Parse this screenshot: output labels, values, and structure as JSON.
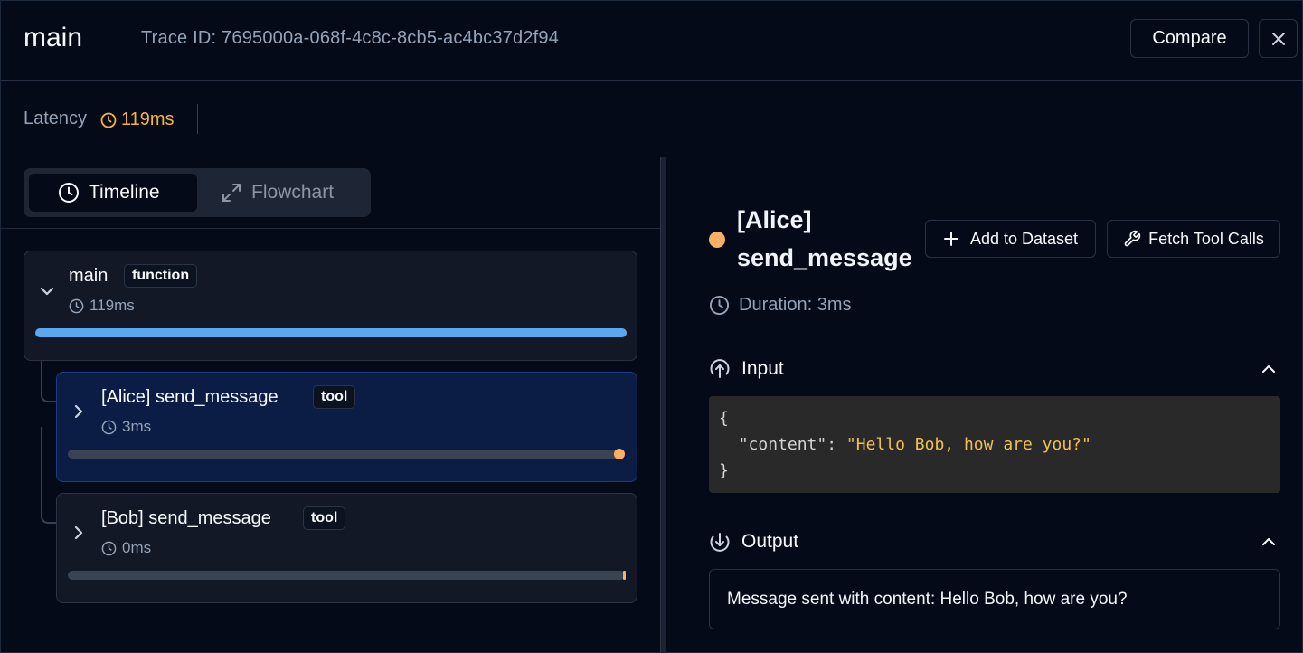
{
  "header": {
    "title": "main",
    "trace_id": "Trace ID: 7695000a-068f-4c8c-8cb5-ac4bc37d2f94",
    "compare_label": "Compare"
  },
  "latency": {
    "label": "Latency",
    "value": "119ms"
  },
  "tabs": [
    {
      "label": "Timeline",
      "icon": "clock-icon",
      "active": true
    },
    {
      "label": "Flowchart",
      "icon": "expand-arrows-icon",
      "active": false
    }
  ],
  "spans": [
    {
      "name": "main",
      "type": "function",
      "duration": "119ms",
      "progress": 1.0,
      "color": "#5aa9f0",
      "expanded": true
    },
    {
      "name": "[Alice] send_message",
      "type": "tool",
      "duration": "3ms",
      "progress": 0.025,
      "color": "#fbb066",
      "selected": true
    },
    {
      "name": "[Bob] send_message",
      "type": "tool",
      "duration": "0ms",
      "progress": 0.0,
      "color": "#fbb066",
      "selected": false
    }
  ],
  "detail": {
    "title_line1": "[Alice]",
    "title_line2": "send_message",
    "add_dataset_label": "Add to Dataset",
    "fetch_tool_calls_label": "Fetch Tool Calls",
    "duration": "Duration: 3ms",
    "input": {
      "heading": "Input",
      "open_brace": "{",
      "key": "\"content\"",
      "value": "\"Hello Bob, how are you?\"",
      "close_brace": "}"
    },
    "output": {
      "heading": "Output",
      "text": "Message sent with content: Hello Bob, how are you?"
    }
  },
  "colors": {
    "accent_orange": "#fbb066",
    "latency_yellow": "#f5b43c",
    "progress_blue": "#5aa9f0",
    "selected_bg": "#0b1d45"
  }
}
